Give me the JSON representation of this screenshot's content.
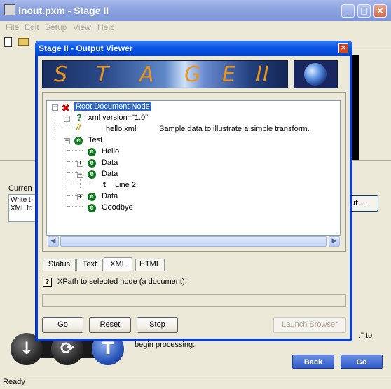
{
  "main_window": {
    "title": "inout.pxm - Stage II",
    "menu": [
      "File",
      "Edit",
      "Setup",
      "View",
      "Help"
    ],
    "current_label": "Curren",
    "current_text_lines": [
      "Write t",
      "XML fo"
    ],
    "output_button_fragment": "ut...",
    "bottom_text_line1": ".\" to",
    "bottom_text_line2": "begin processing.",
    "back_label": "Back",
    "go_label": "Go",
    "status": "Ready"
  },
  "dialog": {
    "title": "Stage II - Output Viewer",
    "banner_letters": [
      "S",
      "T",
      "A",
      "G",
      "E",
      "II"
    ],
    "tree": [
      {
        "label": "Root Document Node",
        "icon": "x-red-icon",
        "selected": true
      },
      {
        "label": "xml version=\"1.0\"",
        "icon": "question-icon"
      },
      {
        "label": "hello.xml",
        "icon": "comment-icon",
        "extra": "Sample data to illustrate a simple transform."
      },
      {
        "label": "Test",
        "icon": "element-icon"
      },
      {
        "label": "Hello",
        "icon": "element-icon"
      },
      {
        "label": "Data",
        "icon": "element-icon"
      },
      {
        "label": "Data",
        "icon": "element-icon"
      },
      {
        "label": "Line 2",
        "icon": "text-icon"
      },
      {
        "label": "Data",
        "icon": "element-icon"
      },
      {
        "label": "Goodbye",
        "icon": "element-icon"
      }
    ],
    "tabs": [
      "Status",
      "Text",
      "XML",
      "HTML"
    ],
    "active_tab": "XML",
    "xpath_label": "XPath to selected node (a document):",
    "xpath_value": "",
    "buttons": {
      "go": "Go",
      "reset": "Reset",
      "stop": "Stop",
      "launch": "Launch Browser"
    }
  }
}
